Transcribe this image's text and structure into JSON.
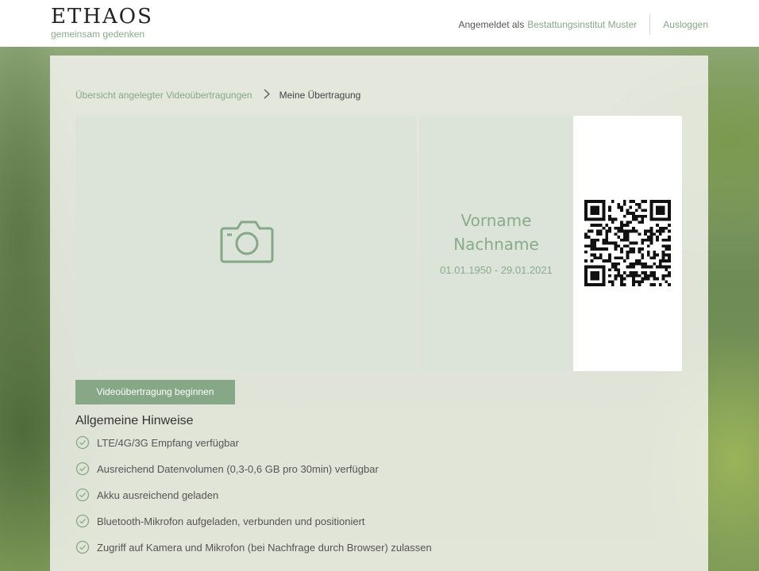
{
  "header": {
    "logo_title": "ETHAOS",
    "logo_subtitle": "gemeinsam gedenken",
    "logged_in_prefix": "Angemeldet als",
    "logged_in_user": "Bestattungsinstitut Muster",
    "logout_label": "Ausloggen"
  },
  "breadcrumb": {
    "link_label": "Übersicht angelegter Videoübertragungen",
    "separator": ">",
    "current": "Meine Übertragung"
  },
  "memorial": {
    "photo_icon": "camera-icon",
    "first_name": "Vorname",
    "last_name": "Nachname",
    "dates": "01.01.1950 - 29.01.2021",
    "qr_icon": "qr-code"
  },
  "actions": {
    "start_label": "Videoübertragung beginnen"
  },
  "hints": {
    "title": "Allgemeine Hinweise",
    "items": [
      "LTE/4G/3G Empfang verfügbar",
      "Ausreichend Datenvolumen (0,3-0,6 GB pro 30min) verfügbar",
      "Akku ausreichend geladen",
      "Bluetooth-Mikrofon aufgeladen, verbunden und positioniert",
      "Zugriff auf Kamera und Mikrofon (bei Nachfrage durch Browser) zulassen"
    ]
  },
  "colors": {
    "accent": "#86a886",
    "tile": "#dce4da"
  }
}
